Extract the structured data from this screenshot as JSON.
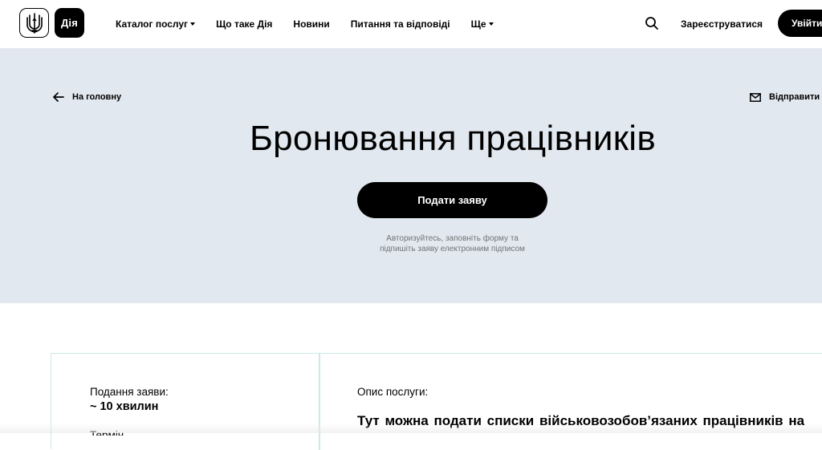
{
  "header": {
    "logo_text": "Дія",
    "nav": [
      {
        "label": "Каталог послуг",
        "has_dropdown": true
      },
      {
        "label": "Що таке Дія",
        "has_dropdown": false
      },
      {
        "label": "Новини",
        "has_dropdown": false
      },
      {
        "label": "Питання та відповіді",
        "has_dropdown": false
      },
      {
        "label": "Ще",
        "has_dropdown": true
      }
    ],
    "search_icon": "search-icon",
    "register_label": "Зареєструватися",
    "login_label": "Увійти"
  },
  "hero": {
    "back_label": "На головну",
    "send_label": "Відправити н",
    "title": "Бронювання працівників",
    "apply_label": "Подати заяву",
    "hint_line1": "Авторизуйтесь, заповніть форму та",
    "hint_line2": "підпишіть заяву електронним підписом"
  },
  "info": {
    "duration_label": "Подання заяви:",
    "duration_value": "~ 10 хвилин",
    "next_label": "Термін",
    "description_label": "Опис послуги:",
    "description_text": "Тут можна подати списки військовозобов’язаних працівників на"
  },
  "colors": {
    "hero_bg": "#e2e8ef",
    "accent": "#000000",
    "panel_border": "#cfe9e6",
    "hint_text": "#6f7478"
  }
}
